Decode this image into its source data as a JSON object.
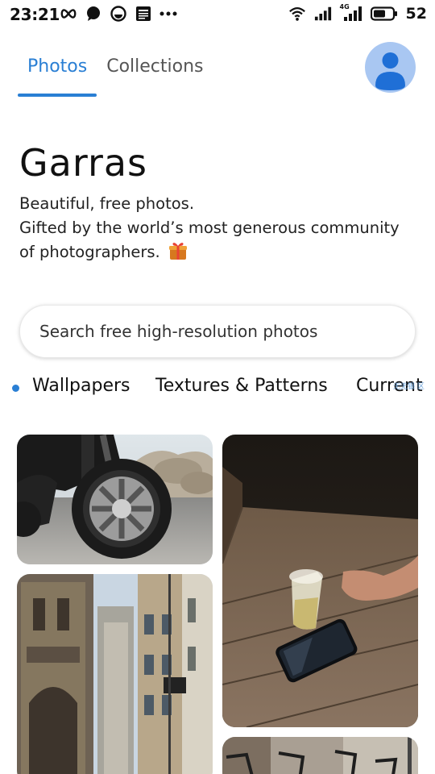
{
  "status_bar": {
    "time": "23:21",
    "battery": "52",
    "network_label": "4G",
    "left_icons": [
      "infinity-icon",
      "chat-bubble-icon",
      "pie-icon",
      "news-icon",
      "more-dots-icon"
    ],
    "right_icons": [
      "wifi-icon",
      "signal-icon",
      "signal-4g-icon",
      "battery-icon"
    ]
  },
  "tabs": [
    {
      "label": "Photos",
      "active": true
    },
    {
      "label": "Collections",
      "active": false
    }
  ],
  "hero": {
    "title": "Garras",
    "line1": "Beautiful, free photos.",
    "line2": "Gifted by the world’s most generous community of photographers."
  },
  "search": {
    "placeholder": "Search free high-resolution photos"
  },
  "topics": [
    "Wallpapers",
    "Textures & Patterns",
    "Current"
  ],
  "watermark": "无无银 区",
  "photos": [
    {
      "subject": "motorcycle",
      "icon": "motorcycle-photo"
    },
    {
      "subject": "glass-and-phone-on-wooden-floor",
      "icon": "glass-photo"
    },
    {
      "subject": "city-street-buildings",
      "icon": "street-photo"
    },
    {
      "subject": "bicycles-in-street",
      "icon": "bikes-photo"
    }
  ],
  "colors": {
    "accent": "#2a7fd4",
    "avatar_bg": "#a9c7f2",
    "avatar_fg": "#1f6fd6"
  }
}
